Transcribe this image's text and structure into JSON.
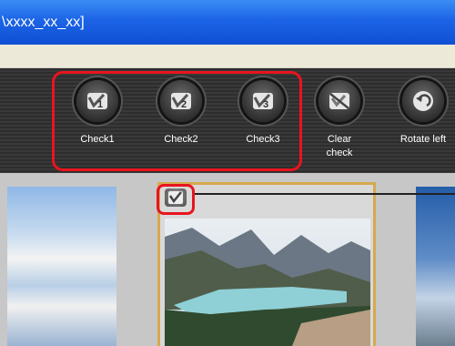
{
  "window": {
    "title": "\\xxxx_xx_xx]"
  },
  "toolbar": {
    "buttons": [
      {
        "label": "Check1",
        "icon": "check1-icon"
      },
      {
        "label": "Check2",
        "icon": "check2-icon"
      },
      {
        "label": "Check3",
        "icon": "check3-icon"
      },
      {
        "label_line1": "Clear",
        "label_line2": "check",
        "icon": "clear-check-icon"
      },
      {
        "label": "Rotate left",
        "icon": "rotate-left-icon"
      }
    ]
  },
  "colors": {
    "title_bar": "#1c64e6",
    "highlight": "#e8141e",
    "selection_border": "#d6a94e",
    "toolbar_bg": "#333333"
  }
}
